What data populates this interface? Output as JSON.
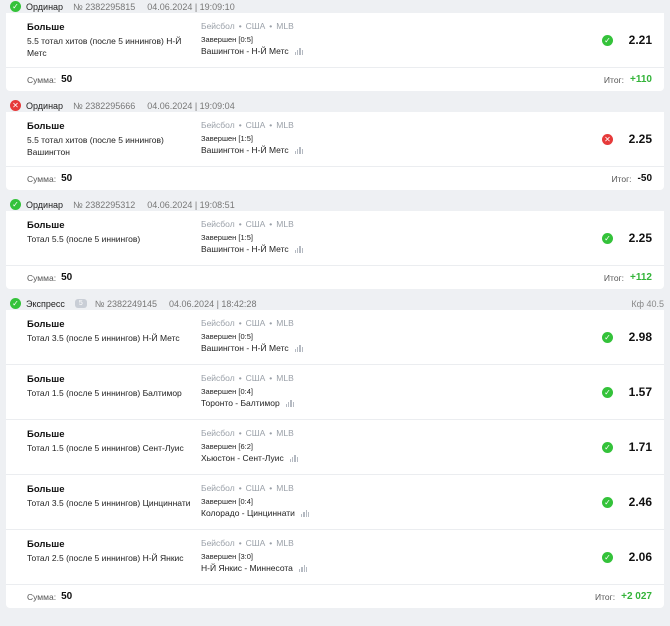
{
  "colors": {
    "won": "#34c23a",
    "lost": "#e63a3a",
    "positive": "#34b43a"
  },
  "bets": [
    {
      "status": "won",
      "status_icon": "check-circle-icon",
      "type": "Ординар",
      "number": "№ 2382295815",
      "date": "04.06.2024 | 19:09:10",
      "selections": [
        {
          "market": "Больше",
          "outcome": "5.5 тотал хитов (после 5 иннингов) Н-Й Метс",
          "sport": "Бейсбол",
          "country": "США",
          "league": "MLB",
          "status_text": "Завершен [0:5]",
          "teams": "Вашингтон - Н-Й Метс",
          "result": "won",
          "odds": "2.21"
        }
      ],
      "sum_label": "Сумма:",
      "sum": "50",
      "result_label": "Итог:",
      "result": "+110",
      "result_sign": "pos"
    },
    {
      "status": "lost",
      "status_icon": "x-circle-icon",
      "type": "Ординар",
      "number": "№ 2382295666",
      "date": "04.06.2024 | 19:09:04",
      "selections": [
        {
          "market": "Больше",
          "outcome": "5.5 тотал хитов (после 5 иннингов) Вашингтон",
          "sport": "Бейсбол",
          "country": "США",
          "league": "MLB",
          "status_text": "Завершен [1:5]",
          "teams": "Вашингтон - Н-Й Метс",
          "result": "lost",
          "odds": "2.25"
        }
      ],
      "sum_label": "Сумма:",
      "sum": "50",
      "result_label": "Итог:",
      "result": "-50",
      "result_sign": "neg"
    },
    {
      "status": "won",
      "status_icon": "check-circle-icon",
      "type": "Ординар",
      "number": "№ 2382295312",
      "date": "04.06.2024 | 19:08:51",
      "selections": [
        {
          "market": "Больше",
          "outcome": "Тотал 5.5 (после 5 иннингов)",
          "sport": "Бейсбол",
          "country": "США",
          "league": "MLB",
          "status_text": "Завершен [1:5]",
          "teams": "Вашингтон - Н-Й Метс",
          "result": "won",
          "odds": "2.25"
        }
      ],
      "sum_label": "Сумма:",
      "sum": "50",
      "result_label": "Итог:",
      "result": "+112",
      "result_sign": "pos"
    },
    {
      "status": "won",
      "status_icon": "check-circle-icon",
      "type": "Экспресс",
      "badge": "5",
      "number": "№ 2382249145",
      "date": "04.06.2024 | 18:42:28",
      "coef": "Кф 40.5",
      "selections": [
        {
          "market": "Больше",
          "outcome": "Тотал 3.5 (после 5 иннингов) Н-Й Метс",
          "sport": "Бейсбол",
          "country": "США",
          "league": "MLB",
          "status_text": "Завершен [0:5]",
          "teams": "Вашингтон - Н-Й Метс",
          "result": "won",
          "odds": "2.98"
        },
        {
          "market": "Больше",
          "outcome": "Тотал 1.5 (после 5 иннингов) Балтимор",
          "sport": "Бейсбол",
          "country": "США",
          "league": "MLB",
          "status_text": "Завершен [0:4]",
          "teams": "Торонто - Балтимор",
          "result": "won",
          "odds": "1.57"
        },
        {
          "market": "Больше",
          "outcome": "Тотал 1.5 (после 5 иннингов) Сент-Луис",
          "sport": "Бейсбол",
          "country": "США",
          "league": "MLB",
          "status_text": "Завершен [6:2]",
          "teams": "Хьюстон - Сент-Луис",
          "result": "won",
          "odds": "1.71"
        },
        {
          "market": "Больше",
          "outcome": "Тотал 3.5 (после 5 иннингов) Цинциннати",
          "sport": "Бейсбол",
          "country": "США",
          "league": "MLB",
          "status_text": "Завершен [0:4]",
          "teams": "Колорадо - Цинциннати",
          "result": "won",
          "odds": "2.46"
        },
        {
          "market": "Больше",
          "outcome": "Тотал 2.5 (после 5 иннингов) Н-Й Янкис",
          "sport": "Бейсбол",
          "country": "США",
          "league": "MLB",
          "status_text": "Завершен [3:0]",
          "teams": "Н-Й Янкис - Миннесота",
          "result": "won",
          "odds": "2.06"
        }
      ],
      "sum_label": "Сумма:",
      "sum": "50",
      "result_label": "Итог:",
      "result": "+2 027",
      "result_sign": "pos"
    }
  ]
}
